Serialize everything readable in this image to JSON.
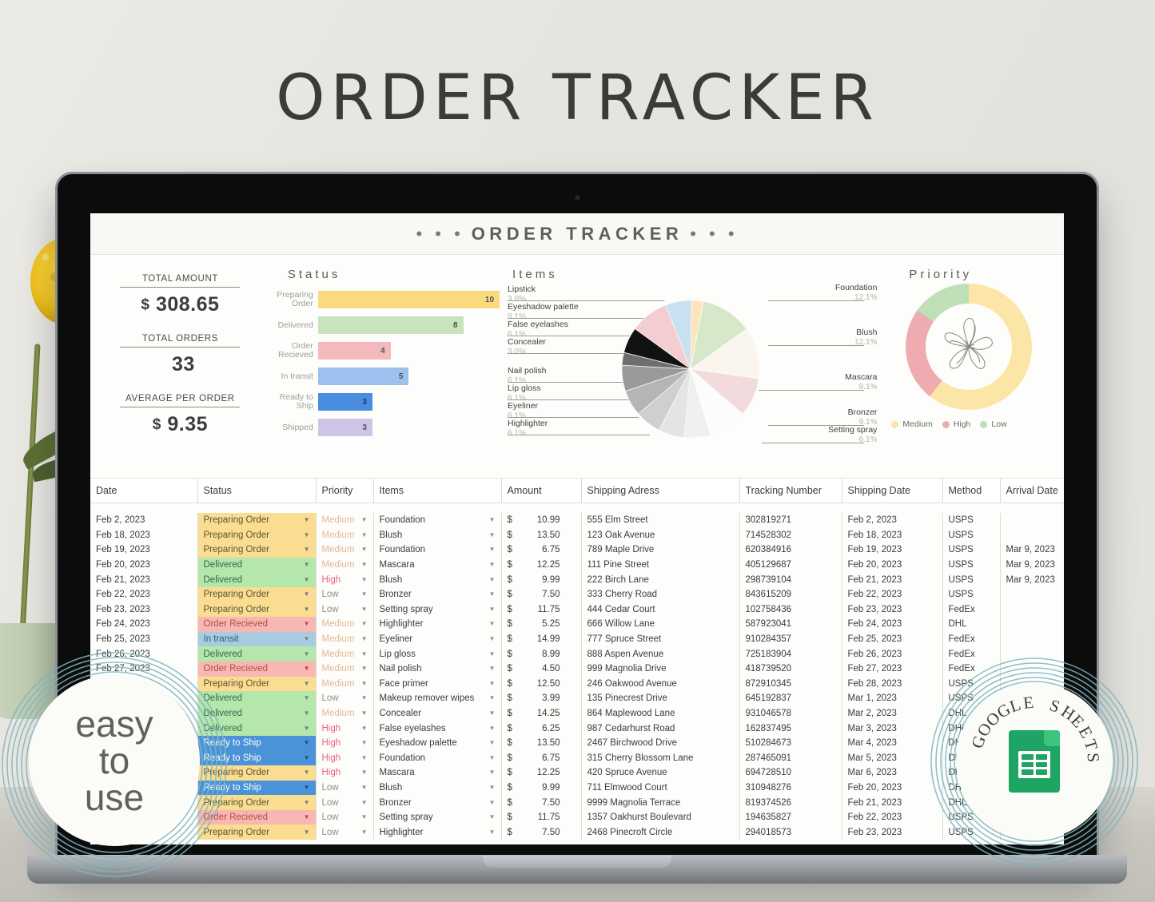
{
  "page": {
    "title": "ORDER TRACKER"
  },
  "sheet": {
    "header_dots": "• • •",
    "title": "ORDER TRACKER"
  },
  "kpis": [
    {
      "label": "TOTAL AMOUNT",
      "currency": "$",
      "value": "308.65"
    },
    {
      "label": "TOTAL ORDERS",
      "currency": "",
      "value": "33"
    },
    {
      "label": "AVERAGE PER ORDER",
      "currency": "$",
      "value": "9.35"
    }
  ],
  "status_chart": {
    "type": "bar",
    "title": "Status",
    "orientation": "horizontal",
    "categories": [
      "Preparing Order",
      "Delivered",
      "Order Recieved",
      "In transit",
      "Ready to Ship",
      "Shipped"
    ],
    "values": [
      10,
      8,
      4,
      5,
      3,
      3
    ],
    "colors": [
      "#fad97f",
      "#c9e3bd",
      "#f3b9bd",
      "#9dc1ee",
      "#4a8de0",
      "#cec4e8"
    ],
    "xlabel": "",
    "ylabel": "",
    "xlim": [
      0,
      10
    ],
    "grid": false
  },
  "items_chart": {
    "type": "pie",
    "title": "Items",
    "labels": [
      "Foundation",
      "Blush",
      "Mascara",
      "Bronzer",
      "Setting spray",
      "Highlighter",
      "Eyeliner",
      "Lip gloss",
      "Nail polish",
      "Concealer",
      "False eyelashes",
      "Eyeshadow palette",
      "Lipstick"
    ],
    "percents": [
      "12.1%",
      "12.1%",
      "9.1%",
      "9.1%",
      "6.1%",
      "6.1%",
      "6.1%",
      "6.1%",
      "6.1%",
      "3.0%",
      "6.1%",
      "9.1%",
      "3.0%"
    ],
    "values": [
      12.1,
      12.1,
      9.1,
      9.1,
      6.1,
      6.1,
      6.1,
      6.1,
      6.1,
      3.0,
      6.1,
      9.1,
      3.0
    ],
    "colors": [
      "#d7e7c9",
      "#faf6ee",
      "#f2dbdd",
      "#fbfbfb",
      "#f0f0f0",
      "#e2e2e2",
      "#cfcfcf",
      "#b7b7b7",
      "#9c9c9c",
      "#5e5e5e",
      "#0d0d0d",
      "#f4cdd2",
      "#c9e0f0",
      "#ffe3bd"
    ],
    "legend_position": "labels-outside"
  },
  "priority_chart": {
    "type": "pie",
    "title": "Priority",
    "donut": true,
    "labels": [
      "Medium",
      "High",
      "Low"
    ],
    "values": [
      60.6,
      24.2,
      15.2
    ],
    "colors": [
      "#fbe6a8",
      "#eeacb0",
      "#bfdfb8"
    ],
    "legend_position": "bottom",
    "center_graphic": "flower-line-art"
  },
  "table": {
    "columns": [
      "Date",
      "Status",
      "Priority",
      "Items",
      "Amount",
      "Shipping Adress",
      "Tracking Number",
      "Shipping Date",
      "Method",
      "Arrival Date"
    ],
    "currency_symbol": "$",
    "status_colors": {
      "Preparing Order": "#fadd90",
      "Delivered": "#b5e6ac",
      "Order Recieved": "#f7b7b3",
      "In transit": "#a8cbe0",
      "Ready to Ship": "#4a93d6"
    },
    "status_text_colors": {
      "Preparing Order": "#5d5437",
      "Delivered": "#2f6a46",
      "Order Recieved": "#b4503f",
      "In transit": "#2d5f7a",
      "Ready to Ship": "#ffffff"
    },
    "priority_colors": {
      "Medium": "#e8b88f",
      "High": "#ec5f7e",
      "Low": "#8e8e8a"
    },
    "rows": [
      {
        "date": "Feb 2, 2023",
        "status": "Preparing Order",
        "priority": "Medium",
        "item": "Foundation",
        "amount": "10.99",
        "address": "555 Elm Street",
        "tracking": "302819271",
        "ship_date": "Feb 2, 2023",
        "method": "USPS",
        "arrival": ""
      },
      {
        "date": "Feb 18, 2023",
        "status": "Preparing Order",
        "priority": "Medium",
        "item": "Blush",
        "amount": "13.50",
        "address": "123 Oak Avenue",
        "tracking": "714528302",
        "ship_date": "Feb 18, 2023",
        "method": "USPS",
        "arrival": ""
      },
      {
        "date": "Feb 19, 2023",
        "status": "Preparing Order",
        "priority": "Medium",
        "item": "Foundation",
        "amount": "6.75",
        "address": "789 Maple Drive",
        "tracking": "620384916",
        "ship_date": "Feb 19, 2023",
        "method": "USPS",
        "arrival": "Mar 9, 2023"
      },
      {
        "date": "Feb 20, 2023",
        "status": "Delivered",
        "priority": "Medium",
        "item": "Mascara",
        "amount": "12.25",
        "address": "111 Pine Street",
        "tracking": "405129687",
        "ship_date": "Feb 20, 2023",
        "method": "USPS",
        "arrival": "Mar 9, 2023"
      },
      {
        "date": "Feb 21, 2023",
        "status": "Delivered",
        "priority": "High",
        "item": "Blush",
        "amount": "9.99",
        "address": "222 Birch Lane",
        "tracking": "298739104",
        "ship_date": "Feb 21, 2023",
        "method": "USPS",
        "arrival": "Mar 9, 2023"
      },
      {
        "date": "Feb 22, 2023",
        "status": "Preparing Order",
        "priority": "Low",
        "item": "Bronzer",
        "amount": "7.50",
        "address": "333 Cherry Road",
        "tracking": "843615209",
        "ship_date": "Feb 22, 2023",
        "method": "USPS",
        "arrival": ""
      },
      {
        "date": "Feb 23, 2023",
        "status": "Preparing Order",
        "priority": "Low",
        "item": "Setting spray",
        "amount": "11.75",
        "address": "444 Cedar Court",
        "tracking": "102758436",
        "ship_date": "Feb 23, 2023",
        "method": "FedEx",
        "arrival": ""
      },
      {
        "date": "Feb 24, 2023",
        "status": "Order Recieved",
        "priority": "Medium",
        "item": "Highlighter",
        "amount": "5.25",
        "address": "666 Willow Lane",
        "tracking": "587923041",
        "ship_date": "Feb 24, 2023",
        "method": "DHL",
        "arrival": ""
      },
      {
        "date": "Feb 25, 2023",
        "status": "In transit",
        "priority": "Medium",
        "item": "Eyeliner",
        "amount": "14.99",
        "address": "777 Spruce Street",
        "tracking": "910284357",
        "ship_date": "Feb 25, 2023",
        "method": "FedEx",
        "arrival": ""
      },
      {
        "date": "Feb 26, 2023",
        "status": "Delivered",
        "priority": "Medium",
        "item": "Lip gloss",
        "amount": "8.99",
        "address": "888 Aspen Avenue",
        "tracking": "725183904",
        "ship_date": "Feb 26, 2023",
        "method": "FedEx",
        "arrival": ""
      },
      {
        "date": "Feb 27, 2023",
        "status": "Order Recieved",
        "priority": "Medium",
        "item": "Nail polish",
        "amount": "4.50",
        "address": "999 Magnolia Drive",
        "tracking": "418739520",
        "ship_date": "Feb 27, 2023",
        "method": "FedEx",
        "arrival": ""
      },
      {
        "date": "",
        "status": "Preparing Order",
        "priority": "Medium",
        "item": "Face primer",
        "amount": "12.50",
        "address": "246 Oakwood Avenue",
        "tracking": "872910345",
        "ship_date": "Feb 28, 2023",
        "method": "USPS",
        "arrival": ""
      },
      {
        "date": "",
        "status": "Delivered",
        "priority": "Low",
        "item": "Makeup remover wipes",
        "amount": "3.99",
        "address": "135 Pinecrest Drive",
        "tracking": "645192837",
        "ship_date": "Mar 1, 2023",
        "method": "USPS",
        "arrival": ""
      },
      {
        "date": "",
        "status": "Delivered",
        "priority": "Medium",
        "item": "Concealer",
        "amount": "14.25",
        "address": "864 Maplewood Lane",
        "tracking": "931046578",
        "ship_date": "Mar 2, 2023",
        "method": "DHL",
        "arrival": ""
      },
      {
        "date": "",
        "status": "Delivered",
        "priority": "High",
        "item": "False eyelashes",
        "amount": "6.25",
        "address": "987 Cedarhurst Road",
        "tracking": "162837495",
        "ship_date": "Mar 3, 2023",
        "method": "DHL",
        "arrival": ""
      },
      {
        "date": "",
        "status": "Ready to Ship",
        "priority": "High",
        "item": "Eyeshadow palette",
        "amount": "13.50",
        "address": "2467 Birchwood Drive",
        "tracking": "510284673",
        "ship_date": "Mar 4, 2023",
        "method": "DHL",
        "arrival": ""
      },
      {
        "date": "",
        "status": "Ready to Ship",
        "priority": "High",
        "item": "Foundation",
        "amount": "6.75",
        "address": "315 Cherry Blossom Lane",
        "tracking": "287465091",
        "ship_date": "Mar 5, 2023",
        "method": "DHL",
        "arrival": ""
      },
      {
        "date": "",
        "status": "Preparing Order",
        "priority": "High",
        "item": "Mascara",
        "amount": "12.25",
        "address": "420 Spruce Avenue",
        "tracking": "694728510",
        "ship_date": "Mar 6, 2023",
        "method": "DHL",
        "arrival": ""
      },
      {
        "date": "",
        "status": "Ready to Ship",
        "priority": "Low",
        "item": "Blush",
        "amount": "9.99",
        "address": "711 Elmwood Court",
        "tracking": "310948276",
        "ship_date": "Feb 20, 2023",
        "method": "DHL",
        "arrival": ""
      },
      {
        "date": "",
        "status": "Preparing Order",
        "priority": "Low",
        "item": "Bronzer",
        "amount": "7.50",
        "address": "9999 Magnolia Terrace",
        "tracking": "819374526",
        "ship_date": "Feb 21, 2023",
        "method": "DHL",
        "arrival": ""
      },
      {
        "date": "",
        "status": "Order Recieved",
        "priority": "Low",
        "item": "Setting spray",
        "amount": "11.75",
        "address": "1357 Oakhurst Boulevard",
        "tracking": "194635827",
        "ship_date": "Feb 22, 2023",
        "method": "USPS",
        "arrival": ""
      },
      {
        "date": "",
        "status": "Preparing Order",
        "priority": "Low",
        "item": "Highlighter",
        "amount": "7.50",
        "address": "2468 Pinecroft Circle",
        "tracking": "294018573",
        "ship_date": "Feb 23, 2023",
        "method": "USPS",
        "arrival": ""
      }
    ]
  },
  "badges": {
    "easy": {
      "line1": "easy",
      "line2": "to",
      "line3": "use"
    },
    "google_sheets": {
      "ring_text": "GOOGLE SHEETS"
    }
  }
}
